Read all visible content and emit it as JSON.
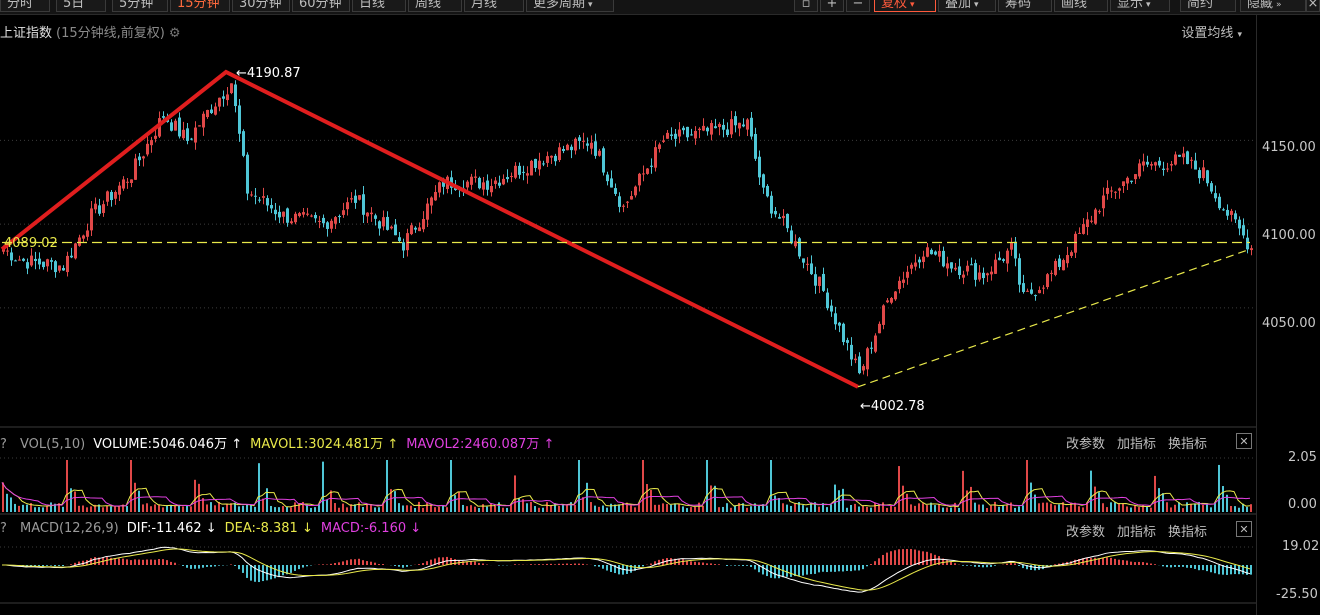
{
  "toolbar": {
    "periods": [
      "分时",
      "5日",
      "5分钟",
      "15分钟",
      "30分钟",
      "60分钟",
      "日线",
      "周线",
      "月线",
      "更多周期"
    ],
    "active_period": "15分钟",
    "right_buttons": [
      "复权",
      "叠加",
      "筹码",
      "画线",
      "显示",
      "简约",
      "隐藏"
    ],
    "active_right": "复权"
  },
  "header": {
    "title": "上证指数",
    "subtitle": "(15分钟线,前复权)",
    "ma_setting": "设置均线"
  },
  "colors": {
    "up": "#e04848",
    "down": "#4fc6d6",
    "annotation_line": "#e01e1e",
    "ref_line": "#e8e84a",
    "mavol1": "#e8e84a",
    "mavol2": "#e040e0"
  },
  "price_panel": {
    "y_ticks": [
      "4150.00",
      "4100.00",
      "4050.00"
    ],
    "high_label": "4190.87",
    "low_label": "4002.78",
    "ref_level_label": "4089.02"
  },
  "volume_panel": {
    "name": "VOL(5,10)",
    "volume": "VOLUME:5046.046万",
    "mavol1": "MAVOL1:3024.481万",
    "mavol2": "MAVOL2:2460.087万",
    "y_ticks": [
      "2.05",
      "0.00"
    ],
    "controls": [
      "改参数",
      "加指标",
      "换指标"
    ]
  },
  "macd_panel": {
    "name": "MACD(12,26,9)",
    "dif": "DIF:-11.462",
    "dea": "DEA:-8.381",
    "macd": "MACD:-6.160",
    "y_ticks": [
      "19.02",
      "-25.50"
    ],
    "controls": [
      "改参数",
      "加指标",
      "换指标"
    ]
  },
  "chart_data": {
    "type": "candlestick",
    "ylim": [
      3980,
      4210
    ],
    "gridlines_y": [
      4050,
      4100,
      4150
    ],
    "series": [
      {
        "name": "trend",
        "x_index": [
          0,
          56,
          214
        ],
        "values": [
          4085,
          4190.87,
          4002.78
        ]
      },
      {
        "name": "support",
        "x_index": [
          214,
          312
        ],
        "values": [
          4002.78,
          4085
        ]
      },
      {
        "name": "level",
        "x_index": [
          0,
          312
        ],
        "values": [
          4089.02,
          4089.02
        ]
      }
    ],
    "keypoints": [
      {
        "x_index": 0,
        "price": 4085
      },
      {
        "x_index": 5,
        "price": 4078
      },
      {
        "x_index": 15,
        "price": 4075
      },
      {
        "x_index": 22,
        "price": 4105
      },
      {
        "x_index": 32,
        "price": 4130
      },
      {
        "x_index": 40,
        "price": 4165
      },
      {
        "x_index": 46,
        "price": 4150
      },
      {
        "x_index": 52,
        "price": 4170
      },
      {
        "x_index": 57,
        "price": 4185
      },
      {
        "x_index": 61,
        "price": 4120
      },
      {
        "x_index": 70,
        "price": 4105
      },
      {
        "x_index": 80,
        "price": 4100
      },
      {
        "x_index": 88,
        "price": 4115
      },
      {
        "x_index": 100,
        "price": 4088
      },
      {
        "x_index": 110,
        "price": 4125
      },
      {
        "x_index": 122,
        "price": 4125
      },
      {
        "x_index": 135,
        "price": 4140
      },
      {
        "x_index": 147,
        "price": 4150
      },
      {
        "x_index": 155,
        "price": 4110
      },
      {
        "x_index": 165,
        "price": 4150
      },
      {
        "x_index": 176,
        "price": 4155
      },
      {
        "x_index": 186,
        "price": 4160
      },
      {
        "x_index": 190,
        "price": 4118
      },
      {
        "x_index": 195,
        "price": 4100
      },
      {
        "x_index": 205,
        "price": 4060
      },
      {
        "x_index": 214,
        "price": 4010
      },
      {
        "x_index": 222,
        "price": 4060
      },
      {
        "x_index": 230,
        "price": 4085
      },
      {
        "x_index": 238,
        "price": 4075
      },
      {
        "x_index": 245,
        "price": 4070
      },
      {
        "x_index": 252,
        "price": 4085
      },
      {
        "x_index": 255,
        "price": 4055
      },
      {
        "x_index": 262,
        "price": 4070
      },
      {
        "x_index": 268,
        "price": 4090
      },
      {
        "x_index": 275,
        "price": 4115
      },
      {
        "x_index": 285,
        "price": 4135
      },
      {
        "x_index": 295,
        "price": 4138
      },
      {
        "x_index": 300,
        "price": 4130
      },
      {
        "x_index": 305,
        "price": 4110
      },
      {
        "x_index": 312,
        "price": 4086
      }
    ]
  }
}
